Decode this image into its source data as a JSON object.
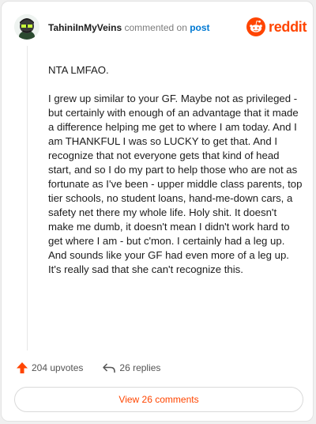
{
  "header": {
    "username": "TahiniInMyVeins",
    "commented_text": "commented on",
    "post_link": "post",
    "brand": "reddit"
  },
  "comment": {
    "paragraphs": [
      "NTA LMFAO.",
      "I grew up similar to your GF. Maybe not as privileged - but certainly with enough of an advantage that it made a difference helping me get to where I am today. And I am THANKFUL I was so LUCKY to get that. And I recognize that not everyone gets that kind of head start, and so I do my part to help those who are not as fortunate as I've been - upper middle class parents, top tier schools, no student loans, hand-me-down cars, a safety net there my whole life. Holy shit. It doesn't make me dumb, it doesn't mean I didn't work hard to get where I am - but c'mon. I certainly had a leg up. And sounds like your GF had even more of a leg up. It's really sad that she can't recognize this."
    ]
  },
  "actions": {
    "upvotes": "204 upvotes",
    "replies": "26 replies"
  },
  "view_comments": "View 26 comments",
  "colors": {
    "brand": "#ff4500",
    "link": "#0079d3",
    "text": "#1c1c1c"
  },
  "icons": {
    "avatar": "snoo-avatar",
    "brand": "reddit-logo-icon",
    "upvote": "upvote-arrow-icon",
    "reply": "reply-arrow-icon"
  }
}
